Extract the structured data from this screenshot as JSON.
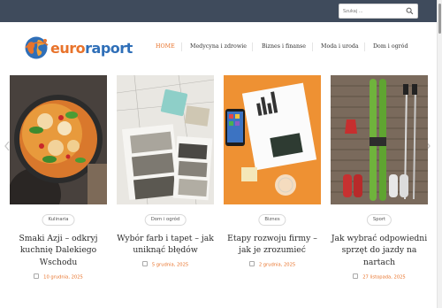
{
  "search": {
    "placeholder": "Szukaj ..."
  },
  "logo": {
    "part1": "euro",
    "part2": "raport"
  },
  "nav": [
    {
      "label": "HOME",
      "active": true
    },
    {
      "label": "Medycyna i zdrowie",
      "active": false
    },
    {
      "label": "Biznes i finanse",
      "active": false
    },
    {
      "label": "Moda i uroda",
      "active": false
    },
    {
      "label": "Dom i ogród",
      "active": false
    }
  ],
  "posts": [
    {
      "category": "Kulinaria",
      "title": "Smaki Azji – odkryj kuchnię Dalekiego Wschodu",
      "date": "10 grudnia, 2025"
    },
    {
      "category": "Dom i ogród",
      "title": "Wybór farb i tapet – jak uniknąć błędów",
      "date": "5 grudnia, 2025"
    },
    {
      "category": "Biznes",
      "title": "Etapy rozwoju firmy – jak je zrozumieć",
      "date": "2 grudnia, 2025"
    },
    {
      "category": "Sport",
      "title": "Jak wybrać odpowiedni sprzęt do jazdy na nartach",
      "date": "27 listopada, 2025"
    }
  ],
  "colors": {
    "accent": "#e8732b",
    "topbar": "#3f4b5c",
    "logo_blue": "#2f6fb8"
  }
}
